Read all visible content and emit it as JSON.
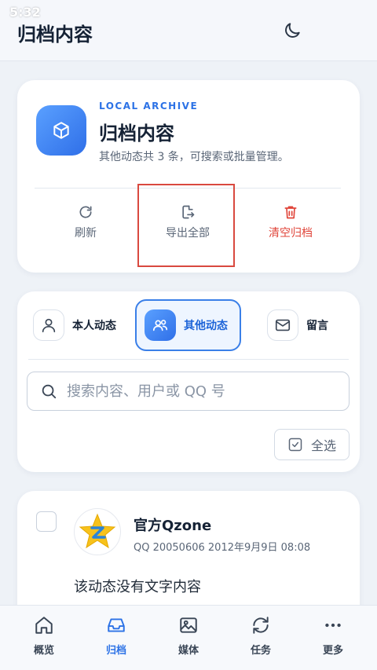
{
  "status_bar": {
    "time": "5:32"
  },
  "app_bar": {
    "title": "归档内容"
  },
  "hero": {
    "eyebrow": "LOCAL ARCHIVE",
    "title": "归档内容",
    "subtitle": "其他动态共 3 条，可搜索或批量管理。",
    "actions": {
      "refresh": "刷新",
      "export": "导出全部",
      "clear": "清空归档"
    }
  },
  "tabs": {
    "self": "本人动态",
    "others": "其他动态",
    "messages": "留言"
  },
  "search": {
    "placeholder": "搜索内容、用户或 QQ 号"
  },
  "select_all": "全选",
  "post": {
    "name": "官方Qzone",
    "meta": "QQ 20050606  2012年9月9日 08:08",
    "body": "该动态没有文字内容"
  },
  "bottom_nav": {
    "overview": "概览",
    "archive": "归档",
    "media": "媒体",
    "tasks": "任务",
    "more": "更多"
  },
  "colors": {
    "accent": "#2c72e6",
    "danger": "#e0453a",
    "background": "#eef2f7"
  }
}
